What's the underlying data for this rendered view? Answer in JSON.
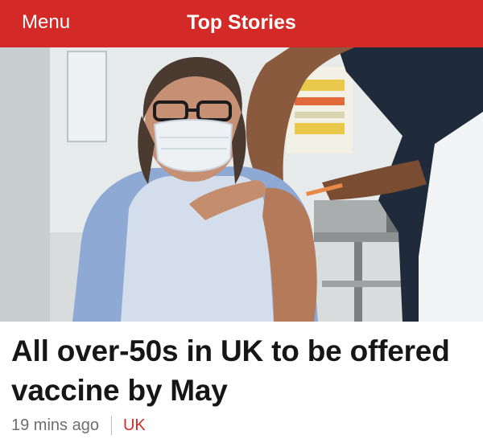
{
  "header": {
    "menu_label": "Menu",
    "title": "Top Stories",
    "bar_color": "#d42a27"
  },
  "story": {
    "image_icon": "photo-icon",
    "headline": "All over-50s in UK to be offered vaccine by May",
    "timestamp": "19 mins ago",
    "section": "UK",
    "section_color": "#d42a27"
  }
}
